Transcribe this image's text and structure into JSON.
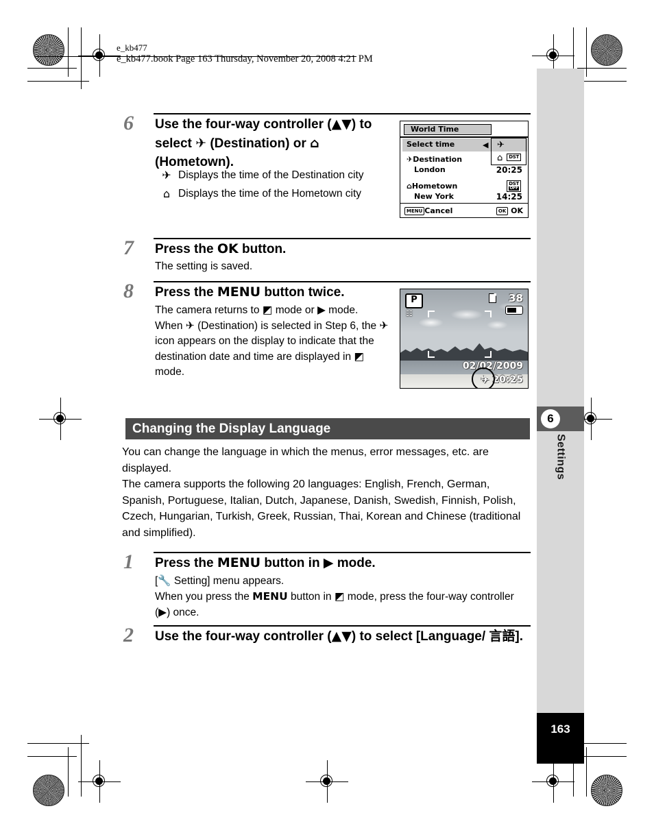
{
  "print_header": {
    "text": "e_kb477.book  Page 163  Thursday, November 20, 2008  4:21 PM",
    "corner_label": "e_kb477"
  },
  "sidebar": {
    "chapter_number": "6",
    "chapter_name": "Settings",
    "page_number": "163"
  },
  "steps": [
    {
      "number": "6",
      "title": "Use the four-way controller (▲▼) to select ✈ (Destination) or ⌂ (Hometown).",
      "sub_items": [
        {
          "icon": "✈",
          "text": "Displays the time of the Destination city"
        },
        {
          "icon": "⌂",
          "text": "Displays the time of the Hometown city"
        }
      ]
    },
    {
      "number": "7",
      "title": "Press the OK button.",
      "body": "The setting is saved."
    },
    {
      "number": "8",
      "title": "Press the MENU button twice.",
      "body": "The camera returns to ▣ mode or ▶ mode. When ✈ (Destination) is selected in Step 6, the ✈ icon appears on the display to indicate that the destination date and time are displayed in ▣ mode."
    },
    {
      "number": "1",
      "title": "Press the MENU button in ▶ mode.",
      "body": "[🔧 Setting] menu appears. When you press the MENU button in ▣ mode, press the four-way controller (▶) once."
    },
    {
      "number": "2",
      "title": "Use the four-way controller (▲▼) to select [Language/ 言語]."
    }
  ],
  "section": {
    "heading": "Changing the Display Language",
    "paragraph1": "You can change the language in which the menus, error messages, etc. are displayed.",
    "paragraph2": "The camera supports the following 20 languages: English, French, German, Spanish, Portuguese, Italian, Dutch, Japanese, Danish, Swedish, Finnish, Polish, Czech, Hungarian, Turkish, Greek, Russian, Thai, Korean and Chinese (traditional and simplified)."
  },
  "world_time_screen": {
    "tab_title": "World Time",
    "select_label": "Select time",
    "arrow": "◀",
    "options": [
      "✈",
      "⌂"
    ],
    "destination_label": "Destination",
    "destination_city": "London",
    "destination_time": "20:25",
    "destination_dst": "DST",
    "hometown_label": "Hometown",
    "hometown_city": "New York",
    "hometown_time": "14:25",
    "hometown_dst": "DST",
    "hometown_dst_state": "OFF",
    "cancel_key": "MENU",
    "cancel_label": "Cancel",
    "ok_key": "OK",
    "ok_label": "OK"
  },
  "photo_screen": {
    "mode": "P",
    "shots_remaining": "38",
    "date": "02/02/2009",
    "time": "20:25",
    "destination_icon": "✈"
  },
  "colors": {
    "section_bar": "#4a4a4a",
    "sidebar_band": "#d8d8d8",
    "chapter_tab": "#5c5c5c",
    "page_box": "#000000"
  }
}
